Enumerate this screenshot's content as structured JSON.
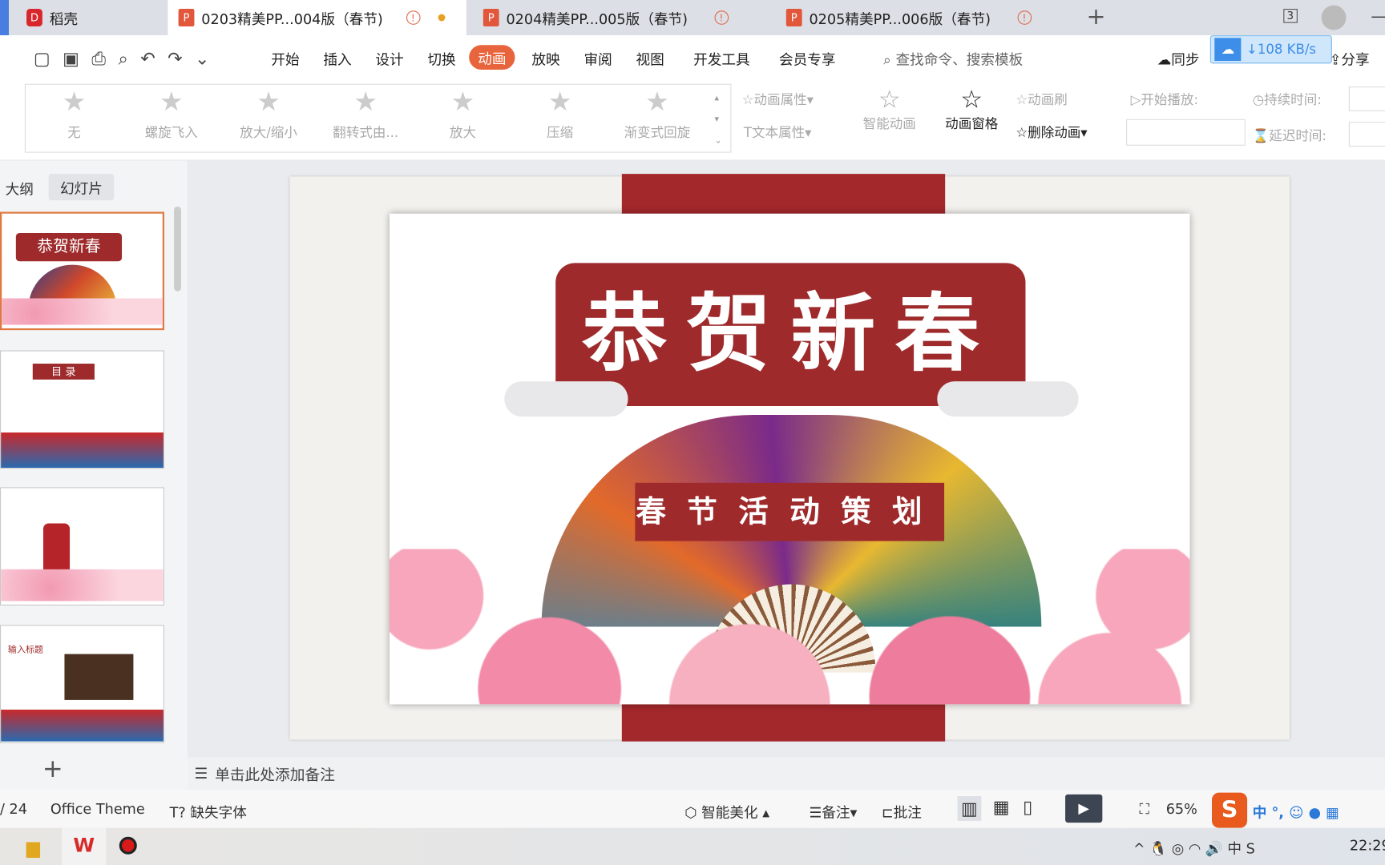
{
  "tabs": [
    {
      "label": "稻壳",
      "active": false
    },
    {
      "label": "0203精美PP...004版（春节)",
      "active": true
    },
    {
      "label": "0204精美PP...005版（春节)",
      "active": false
    },
    {
      "label": "0205精美PP...006版（春节)",
      "active": false
    }
  ],
  "window_badge": "3",
  "menu": [
    "开始",
    "插入",
    "设计",
    "切换",
    "动画",
    "放映",
    "审阅",
    "视图",
    "开发工具",
    "会员专享"
  ],
  "active_menu": "动画",
  "search_placeholder": "查找命令、搜索模板",
  "sync_label": "同步",
  "share_label": "分享",
  "net_speed": "↓108 KB/s",
  "gallery": [
    "无",
    "螺旋飞入",
    "放大/缩小",
    "翻转式由...",
    "放大",
    "压缩",
    "渐变式回旋"
  ],
  "ribbon": {
    "anim_props": "动画属性",
    "text_props": "文本属性",
    "smart_anim": "智能动画",
    "anim_pane": "动画窗格",
    "anim_brush": "动画刷",
    "delete_anim": "删除动画",
    "start_play": "开始播放:",
    "duration": "持续时间:",
    "delay": "延迟时间:"
  },
  "panel_tabs": [
    "大纲",
    "幻灯片"
  ],
  "thumbs": [
    {
      "title": "恭贺新春"
    },
    {
      "title": "目 录"
    },
    {
      "title": ""
    },
    {
      "title": "输入标题"
    }
  ],
  "slide": {
    "title": "恭贺新春",
    "subtitle": "春节活动策划"
  },
  "notes_placeholder": "单击此处添加备注",
  "status": {
    "page": "/ 24",
    "theme": "Office Theme",
    "missing_font": "缺失字体",
    "beautify": "智能美化",
    "notes": "备注",
    "comment": "批注",
    "zoom": "65%"
  },
  "taskbar": {
    "time": "22:29",
    "ime": "中"
  },
  "colors": {
    "accent": "#e8643c",
    "slide_red": "#9e2a2b"
  }
}
